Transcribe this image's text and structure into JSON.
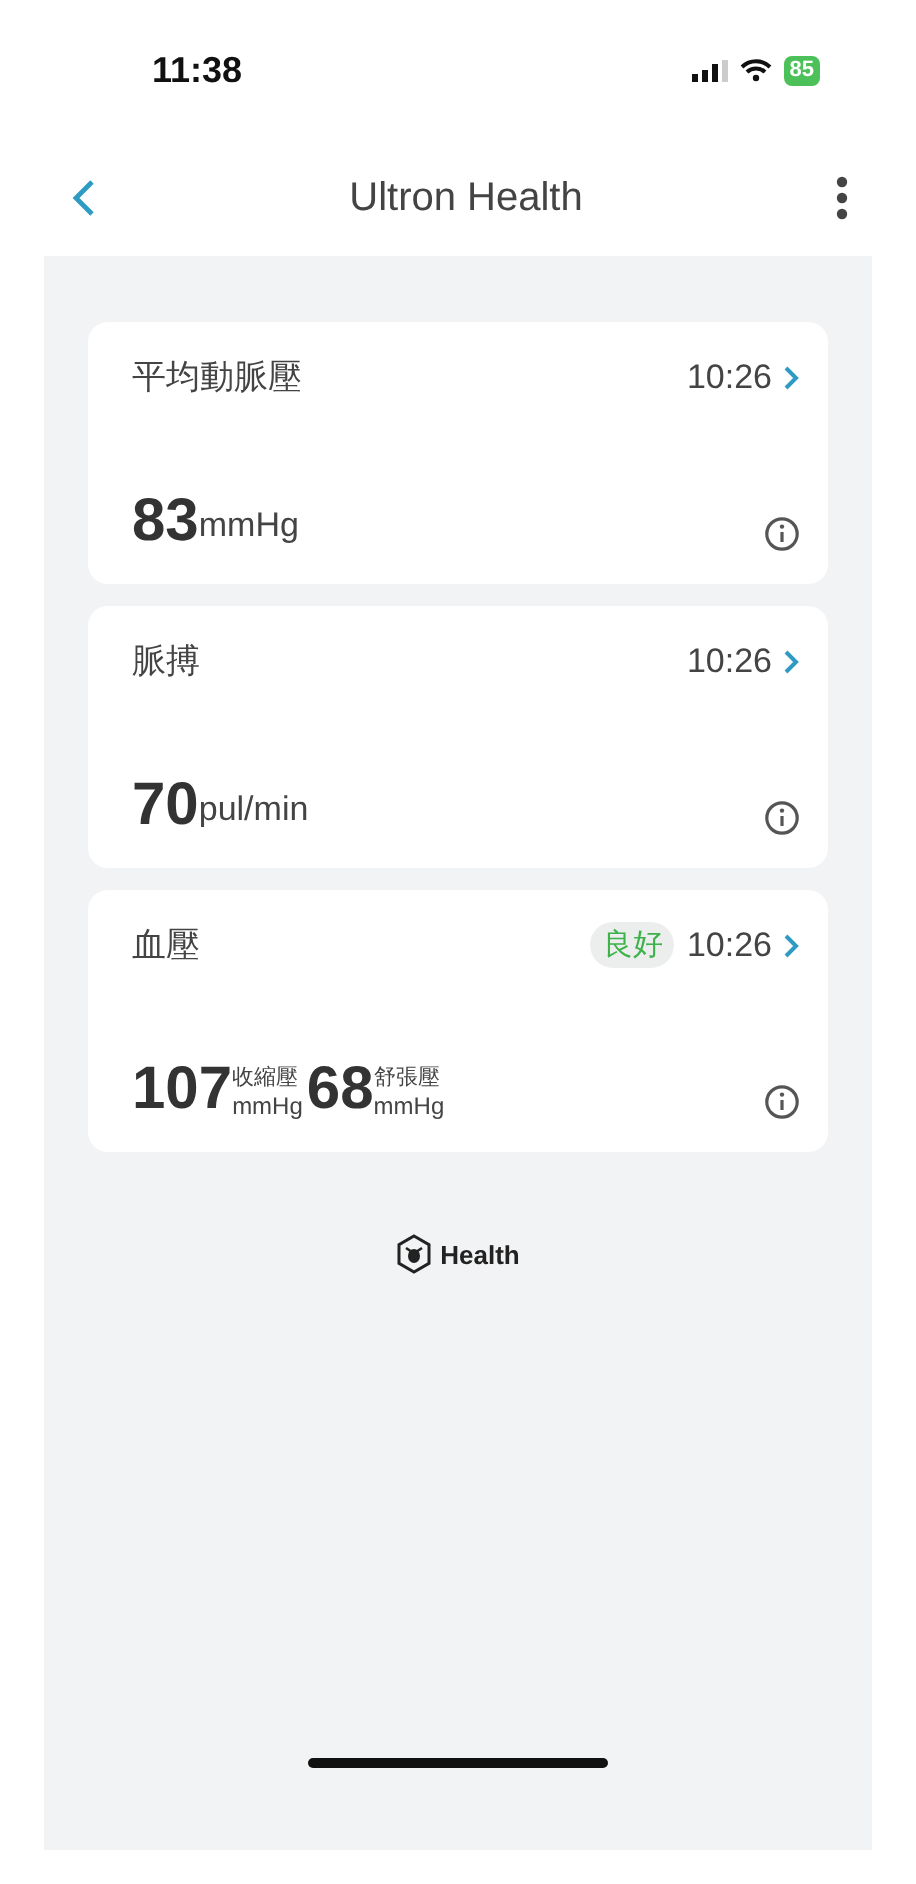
{
  "status_bar": {
    "time": "11:38",
    "battery": "85"
  },
  "nav": {
    "title": "Ultron Health"
  },
  "cards": [
    {
      "kind": "single",
      "title": "平均動脈壓",
      "time": "10:26",
      "value": "83",
      "unit": "mmHg"
    },
    {
      "kind": "single",
      "title": "脈搏",
      "time": "10:26",
      "value": "70",
      "unit": "pul/min"
    },
    {
      "kind": "bp",
      "title": "血壓",
      "badge": "良好",
      "time": "10:26",
      "readings": [
        {
          "value": "107",
          "caption": "收縮壓",
          "unit": "mmHg"
        },
        {
          "value": "68",
          "caption": "舒張壓",
          "unit": "mmHg"
        }
      ]
    }
  ],
  "footer": {
    "brand": "Health"
  }
}
